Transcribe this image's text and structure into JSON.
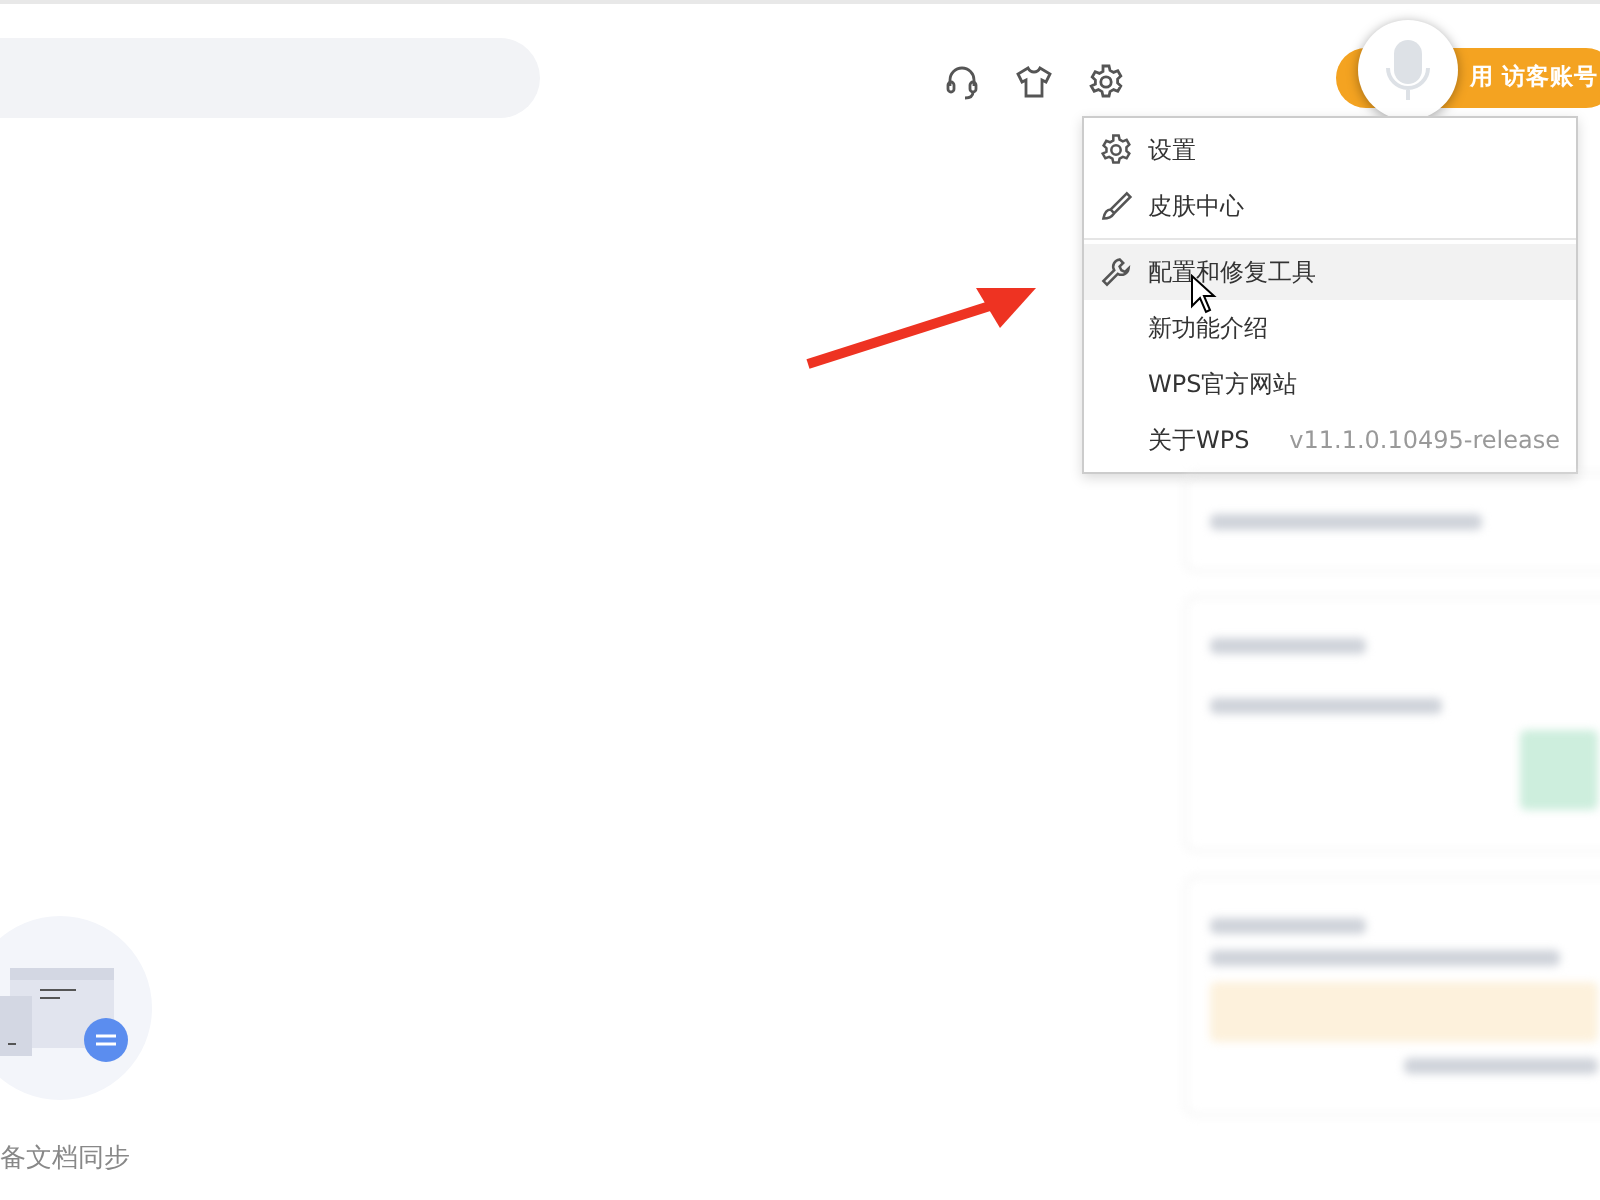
{
  "header": {
    "account_button": {
      "label": "用 访客账号"
    }
  },
  "settings_menu": {
    "items": [
      {
        "kind": "gear",
        "label": "设置",
        "selected": false,
        "divider_before": false
      },
      {
        "kind": "brush",
        "label": "皮肤中心",
        "selected": false,
        "divider_before": false
      },
      {
        "kind": "wrench",
        "label": "配置和修复工具",
        "selected": true,
        "divider_before": true
      },
      {
        "kind": "plain",
        "label": "新功能介绍",
        "selected": false,
        "divider_before": false
      },
      {
        "kind": "plain",
        "label": "WPS官方网站",
        "selected": false,
        "divider_before": false
      },
      {
        "kind": "plain",
        "label": "关于WPS",
        "version": "v11.1.0.10495-release",
        "selected": false,
        "divider_before": false
      }
    ]
  },
  "sync_card": {
    "label": "备文档同步"
  }
}
